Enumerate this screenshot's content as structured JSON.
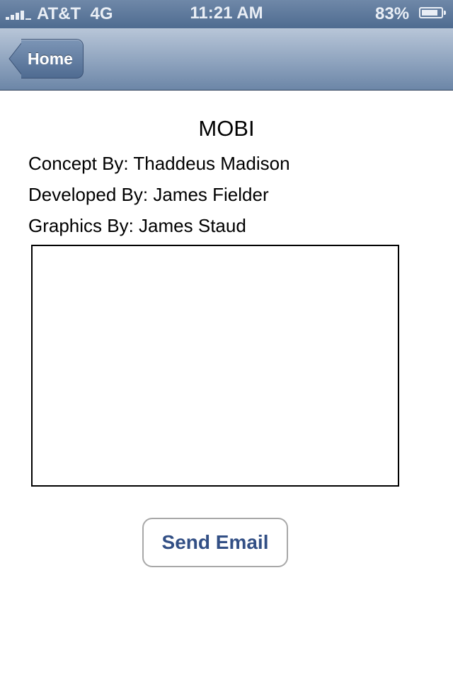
{
  "status_bar": {
    "carrier": "AT&T",
    "network": "4G",
    "time": "11:21 AM",
    "battery_percent": "83%",
    "battery_level": 0.83
  },
  "nav_bar": {
    "back_label": "Home"
  },
  "content": {
    "title": "MOBI",
    "credits": [
      "Concept By: Thaddeus Madison",
      "Developed By: James Fielder",
      "Graphics By: James Staud"
    ],
    "text_area_value": "",
    "send_button_label": "Send Email"
  },
  "colors": {
    "nav_bar": "#8ea3be",
    "button_text": "#324f85"
  },
  "icons": {
    "signal": "signal-bars-icon",
    "battery": "battery-icon",
    "back": "back-arrow-icon"
  }
}
